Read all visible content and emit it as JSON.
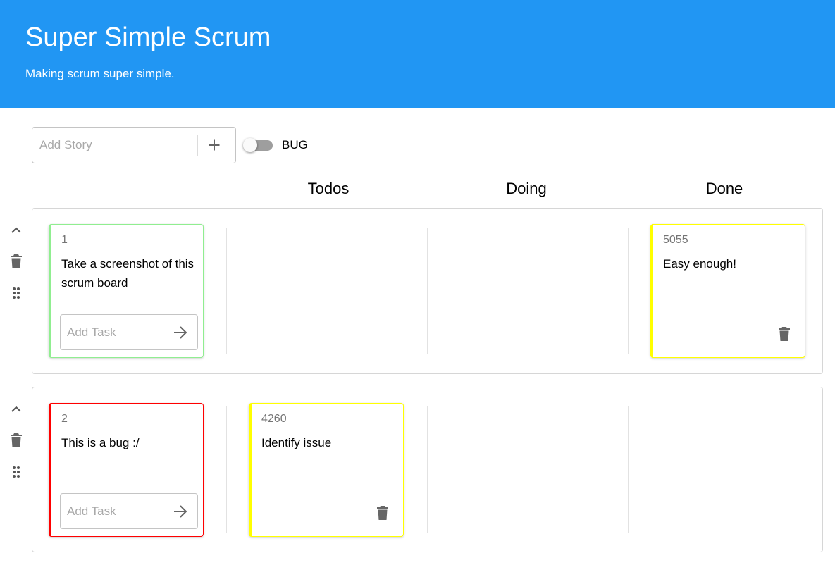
{
  "header": {
    "title": "Super Simple Scrum",
    "subtitle": "Making scrum super simple."
  },
  "toolbar": {
    "add_story_placeholder": "Add Story",
    "bug_toggle_label": "BUG",
    "bug_toggle_on": false
  },
  "columns": [
    "Todos",
    "Doing",
    "Done"
  ],
  "stories": [
    {
      "id": "1",
      "text": "Take a screenshot of this scrum board",
      "type": "story",
      "accent_color": "#90ee90",
      "add_task_placeholder": "Add Task",
      "tasks": {
        "todos": [],
        "doing": [],
        "done": [
          {
            "id": "5055",
            "text": "Easy enough!",
            "accent_color": "#ffff00"
          }
        ]
      }
    },
    {
      "id": "2",
      "text": "This is a bug :/",
      "type": "bug",
      "accent_color": "#ff0000",
      "add_task_placeholder": "Add Task",
      "tasks": {
        "todos": [
          {
            "id": "4260",
            "text": "Identify issue",
            "accent_color": "#ffff00"
          }
        ],
        "doing": [],
        "done": []
      }
    }
  ],
  "icons": {
    "plus": "plus-icon",
    "arrow": "arrow-right-icon",
    "collapse": "chevron-up-icon",
    "delete": "trash-icon",
    "drag": "drag-handle-icon"
  },
  "colors": {
    "header_bg": "#2196f3",
    "story_accent": "#90ee90",
    "bug_accent": "#ff0000",
    "task_accent": "#ffff00",
    "icon_gray": "#757575"
  }
}
